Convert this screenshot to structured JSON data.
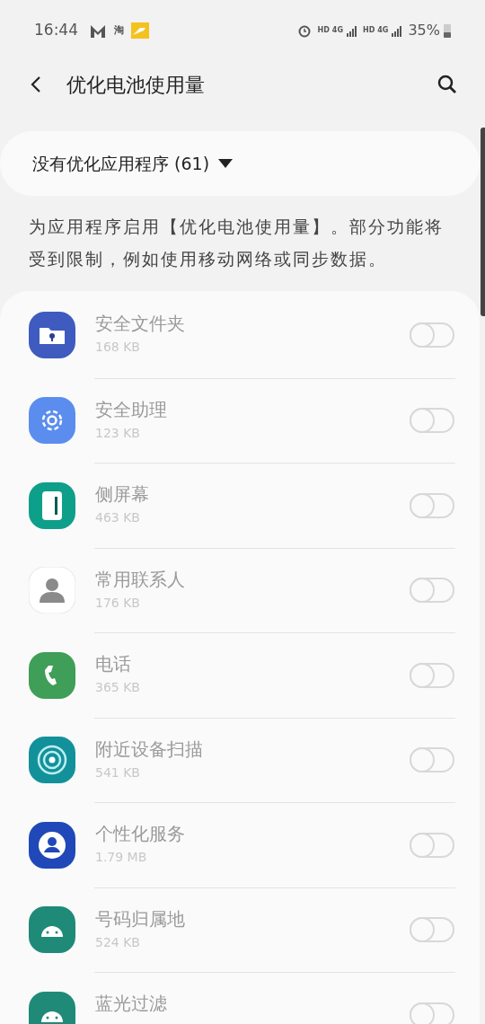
{
  "status_bar": {
    "time": "16:44",
    "notification_text": "淘",
    "network": [
      {
        "hd": "HD",
        "gen": "4G"
      },
      {
        "hd": "HD",
        "gen": "4G"
      }
    ],
    "battery": "35%"
  },
  "header": {
    "title": "优化电池使用量"
  },
  "filter": {
    "label": "没有优化应用程序 (61)"
  },
  "description": "为应用程序启用【优化电池使用量】。部分功能将受到限制，例如使用移动网络或同步数据。",
  "apps": [
    {
      "name": "安全文件夹",
      "size": "168 KB",
      "kind": "folder",
      "on": false
    },
    {
      "name": "安全助理",
      "size": "123 KB",
      "kind": "gear",
      "on": false
    },
    {
      "name": "侧屏幕",
      "size": "463 KB",
      "kind": "edge",
      "on": false
    },
    {
      "name": "常用联系人",
      "size": "176 KB",
      "kind": "contact",
      "on": false
    },
    {
      "name": "电话",
      "size": "365 KB",
      "kind": "phone",
      "on": false
    },
    {
      "name": "附近设备扫描",
      "size": "541 KB",
      "kind": "scan",
      "on": false
    },
    {
      "name": "个性化服务",
      "size": "1.79 MB",
      "kind": "person",
      "on": false
    },
    {
      "name": "号码归属地",
      "size": "524 KB",
      "kind": "android",
      "on": false
    },
    {
      "name": "蓝光过滤",
      "kind": "android",
      "on": false
    }
  ]
}
